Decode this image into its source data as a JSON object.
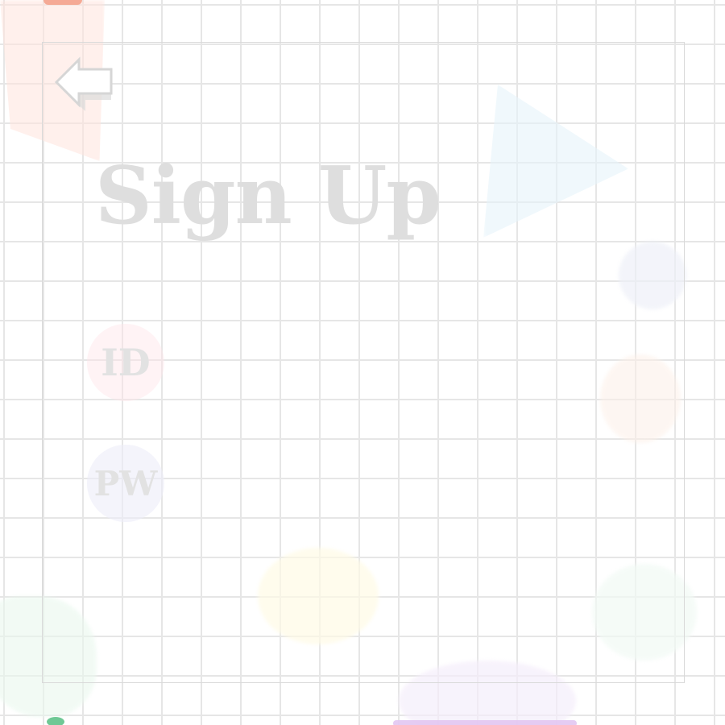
{
  "page": {
    "title": "Sign Up"
  },
  "navigation": {
    "back_icon": "arrow-left-outline-icon"
  },
  "form": {
    "fields": [
      {
        "label": "ID",
        "value": "",
        "placeholder": ""
      },
      {
        "label": "PW",
        "value": "",
        "placeholder": ""
      }
    ]
  },
  "colors": {
    "grid_line": "#e6e6e6",
    "title_text": "#dedede",
    "icon_stroke": "#d6d6d6",
    "accent_coral": "#f4a28c",
    "accent_green": "#5fc28a",
    "accent_purple": "#e2c6f2"
  }
}
